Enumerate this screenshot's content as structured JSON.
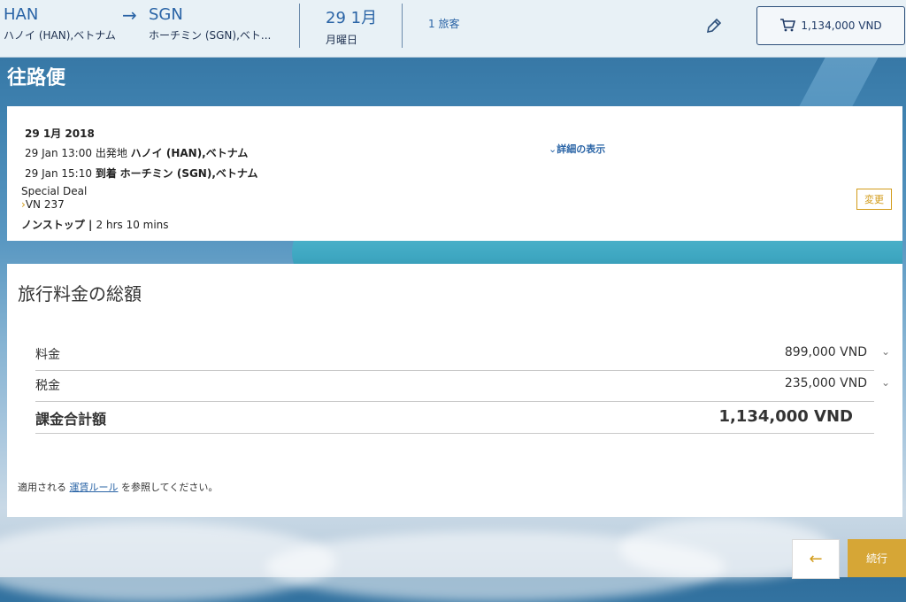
{
  "header": {
    "from_code": "HAN",
    "from_city": "ハノイ (HAN),ベトナム",
    "to_code": "SGN",
    "to_city": "ホーチミン (SGN),ベト...",
    "date": "29 1月",
    "weekday": "月曜日",
    "passengers": "1 旅客",
    "cart_total": "1,134,000 VND",
    "icons": {
      "arrow": "arrow-right-icon",
      "edit": "pencil-icon",
      "cart": "cart-icon"
    }
  },
  "section_title": "往路便",
  "flight": {
    "date": "29 1月 2018",
    "dep_time": "29 Jan 13:00",
    "dep_label": "出発地",
    "dep_place": "ハノイ (HAN),ベトナム",
    "arr_time": "29 Jan 15:10",
    "arr_label": "到着",
    "arr_place": "ホーチミン (SGN),ベトナム",
    "fare_type": "Special Deal",
    "flight_no": "VN 237",
    "stops": "ノンストップ",
    "duration": "2 hrs 10 mins",
    "details_link": "詳細の表示",
    "change_button": "変更"
  },
  "summary": {
    "title": "旅行料金の総額",
    "fare_label": "料金",
    "fare_value": "899,000 VND",
    "tax_label": "税金",
    "tax_value": "235,000 VND",
    "total_label": "課金合計額",
    "total_value": "1,134,000 VND",
    "note_prefix": "適用される",
    "note_link": "運賃ルール",
    "note_suffix": "を参照してください。"
  },
  "footer": {
    "back_icon": "arrow-left-icon",
    "continue_label": "続行"
  },
  "colors": {
    "accent_gold": "#d6a636",
    "link_blue": "#2a64a6"
  }
}
